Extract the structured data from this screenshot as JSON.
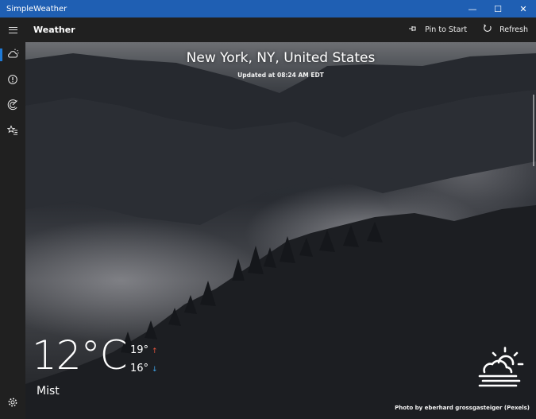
{
  "window": {
    "title": "SimpleWeather",
    "minimize_glyph": "—",
    "maximize_glyph": "☐",
    "close_glyph": "✕"
  },
  "appbar": {
    "page_title": "Weather",
    "pin_label": "Pin to Start",
    "refresh_label": "Refresh",
    "pin_icon": "pin-icon",
    "refresh_icon": "refresh-icon"
  },
  "nav": {
    "items": [
      {
        "icon": "weather-icon",
        "active": true
      },
      {
        "icon": "alert-icon",
        "active": false
      },
      {
        "icon": "radar-icon",
        "active": false
      },
      {
        "icon": "favorites-icon",
        "active": false
      }
    ],
    "settings_icon": "gear-icon"
  },
  "weather": {
    "location": "New York, NY, United States",
    "updated": "Updated at 08:24 AM EDT",
    "temperature": "12°C",
    "high": "19°",
    "low": "16°",
    "up_arrow": "↑",
    "down_arrow": "↓",
    "condition": "Mist",
    "condition_icon": "mist-icon",
    "photo_credit": "Photo by eberhard grossgasteiger (Pexels)"
  },
  "colors": {
    "titlebar": "#1f5fb3",
    "appbar": "#202020",
    "accent": "#1f7ad6",
    "high_arrow": "#e0533d",
    "low_arrow": "#3fa3e6"
  }
}
